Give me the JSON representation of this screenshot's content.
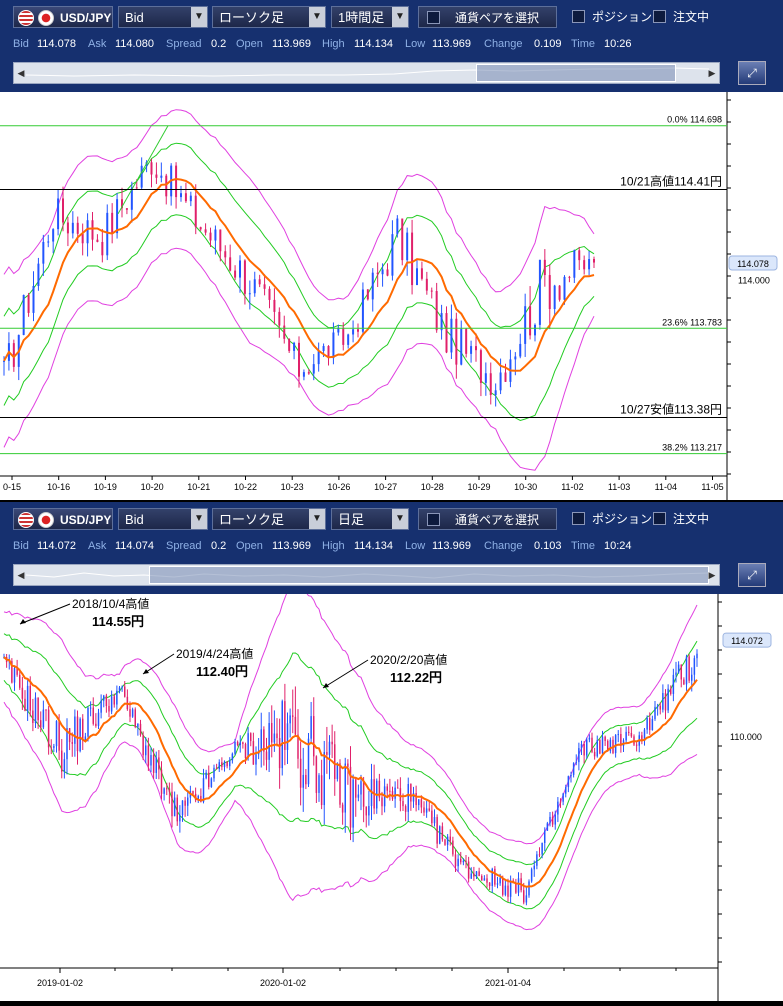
{
  "top": {
    "symbol": "USD/JPY",
    "price_type": "Bid",
    "chart_type": "ローソク足",
    "timeframe": "1時間足",
    "pair_select": "通貨ペアを選択",
    "position_label": "ポジション",
    "order_label": "注文中",
    "quote": {
      "bid_label": "Bid",
      "bid": "114.078",
      "ask_label": "Ask",
      "ask": "114.080",
      "spread_label": "Spread",
      "spread": "0.2",
      "open_label": "Open",
      "open": "113.969",
      "high_label": "High",
      "high": "114.134",
      "low_label": "Low",
      "low": "113.969",
      "change_label": "Change",
      "change": "0.109",
      "time_label": "Time",
      "time": "10:26"
    },
    "price_labels": {
      "current": "114.078",
      "tick": "114.000"
    },
    "fib": [
      {
        "label": "0.0%  114.698",
        "price": 114.698
      },
      {
        "label": "23.6%  113.783",
        "price": 113.783
      },
      {
        "label": "38.2%  113.217",
        "price": 113.217
      }
    ],
    "annotations": {
      "high": {
        "text": "10/21高値114.41円",
        "price": 114.41
      },
      "low": {
        "text": "10/27安値113.38円",
        "price": 113.38
      }
    },
    "x_ticks": [
      "0-15",
      "10-16",
      "10-19",
      "10-20",
      "10-21",
      "10-22",
      "10-23",
      "10-26",
      "10-27",
      "10-28",
      "10-29",
      "10-30",
      "11-02",
      "11-03",
      "11-04",
      "11-05"
    ],
    "chart_data": {
      "type": "candlestick",
      "price_range": [
        113.17,
        114.76
      ],
      "x": [
        "10-15",
        "10-16",
        "10-19",
        "10-20",
        "10-21",
        "10-22",
        "10-23",
        "10-26",
        "10-27",
        "10-28",
        "10-29",
        "10-30",
        "11-02"
      ],
      "close": [
        113.55,
        114.3,
        114.2,
        114.55,
        114.25,
        114.0,
        113.6,
        113.75,
        114.2,
        113.75,
        113.55,
        114.0,
        114.08
      ],
      "high": [
        113.85,
        114.42,
        114.38,
        114.7,
        114.41,
        114.15,
        113.85,
        113.95,
        114.3,
        113.95,
        113.75,
        114.41,
        114.25
      ],
      "low": [
        113.22,
        113.9,
        113.85,
        114.2,
        113.9,
        113.55,
        113.4,
        113.55,
        113.65,
        113.38,
        113.25,
        113.5,
        113.95
      ]
    }
  },
  "bottom": {
    "symbol": "USD/JPY",
    "price_type": "Bid",
    "chart_type": "ローソク足",
    "timeframe": "日足",
    "pair_select": "通貨ペアを選択",
    "position_label": "ポジション",
    "order_label": "注文中",
    "quote": {
      "bid_label": "Bid",
      "bid": "114.072",
      "ask_label": "Ask",
      "ask": "114.074",
      "spread_label": "Spread",
      "spread": "0.2",
      "open_label": "Open",
      "open": "113.969",
      "high_label": "High",
      "high": "114.134",
      "low_label": "Low",
      "low": "113.969",
      "change_label": "Change",
      "change": "0.103",
      "time_label": "Time",
      "time": "10:24"
    },
    "price_labels": {
      "current": "114.072",
      "tick": "110.000"
    },
    "annotations": [
      {
        "date": "2018/10/4高値",
        "value": "114.55円"
      },
      {
        "date": "2019/4/24高値",
        "value": "112.40円"
      },
      {
        "date": "2020/2/20高値",
        "value": "112.22円"
      }
    ],
    "x_ticks": [
      "2019-01-02",
      "2020-01-02",
      "2021-01-04"
    ],
    "chart_data": {
      "type": "candlestick",
      "price_range": [
        101.0,
        115.5
      ],
      "x": [
        "2018-10",
        "2019-01",
        "2019-04",
        "2019-08",
        "2019-12",
        "2020-02",
        "2020-03",
        "2020-06",
        "2020-10",
        "2021-01",
        "2021-04",
        "2021-08",
        "2021-10"
      ],
      "close": [
        113.0,
        109.5,
        112.0,
        106.5,
        109.5,
        110.0,
        107.5,
        107.5,
        104.5,
        103.5,
        109.5,
        110.0,
        113.5
      ],
      "high": [
        114.55,
        110.5,
        112.4,
        109.0,
        110.0,
        112.22,
        111.5,
        109.0,
        106.0,
        105.5,
        110.9,
        110.8,
        114.55
      ],
      "low": [
        111.5,
        104.7,
        110.0,
        104.5,
        108.0,
        101.2,
        104.0,
        105.5,
        103.5,
        102.6,
        108.0,
        108.5,
        109.5
      ]
    }
  }
}
